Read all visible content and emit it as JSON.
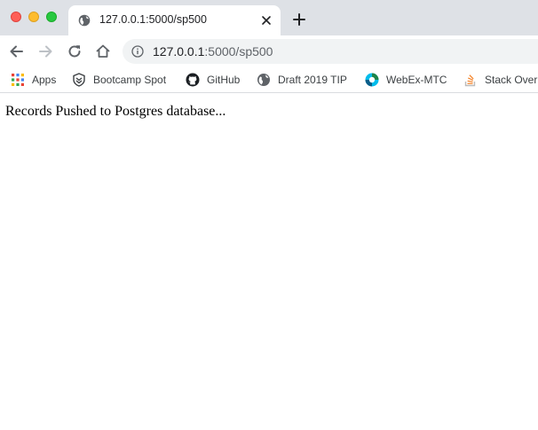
{
  "window": {
    "controls": [
      "close",
      "minimize",
      "maximize"
    ]
  },
  "tab": {
    "title": "127.0.0.1:5000/sp500",
    "favicon": "globe-icon"
  },
  "toolbar": {
    "url_host": "127.0.0.1",
    "url_path": ":5000/sp500"
  },
  "bookmarks": [
    {
      "label": "Apps",
      "icon": "apps-grid-icon"
    },
    {
      "label": "Bootcamp Spot",
      "icon": "bootcamp-shield-icon"
    },
    {
      "label": "GitHub",
      "icon": "github-icon"
    },
    {
      "label": "Draft 2019 TIP",
      "icon": "globe-icon"
    },
    {
      "label": "WebEx-MTC",
      "icon": "webex-icon"
    },
    {
      "label": "Stack Over",
      "icon": "stackoverflow-icon"
    }
  ],
  "page": {
    "message": "Records Pushed to Postgres database..."
  },
  "colors": {
    "tabstrip": "#dee1e6",
    "close": "#fe5f57",
    "minimize": "#febc2e",
    "maximize": "#28c840"
  }
}
